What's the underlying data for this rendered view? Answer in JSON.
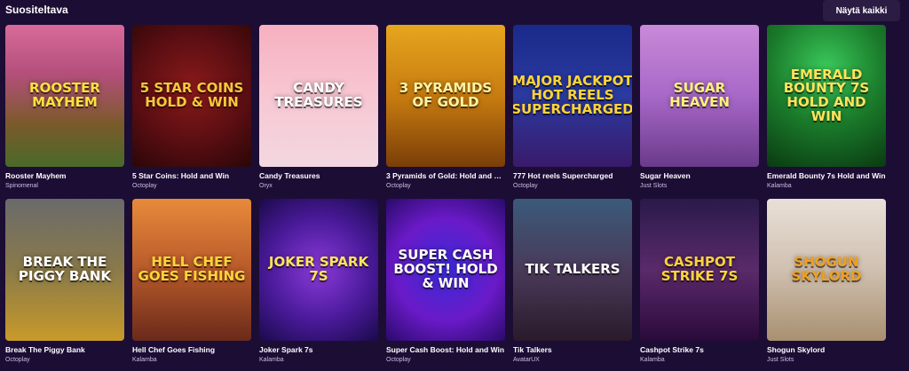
{
  "section": {
    "title": "Suositeltava",
    "show_all_label": "Näytä kaikki"
  },
  "games": [
    {
      "name": "Rooster Mayhem",
      "provider": "Spinomenal",
      "art": "Rooster Mayhem",
      "bg": "linear-gradient(180deg,#d86a9a 0%,#b34f7a 35%,#7a5a2a 70%,#4a6a2a 100%)",
      "color": "#ffe23a"
    },
    {
      "name": "5 Star Coins: Hold and Win",
      "provider": "Octoplay",
      "art": "5 Star Coins Hold & Win",
      "bg": "radial-gradient(circle at 50% 45%,#8a1a1a 0%,#5a0e12 55%,#2a0608 100%)",
      "color": "#f7c83a"
    },
    {
      "name": "Candy Treasures",
      "provider": "Oryx",
      "art": "Candy Treasures",
      "bg": "linear-gradient(180deg,#f6b0c0 0%,#f7c7d2 50%,#f3d7e0 100%)",
      "color": "#ffffff"
    },
    {
      "name": "3 Pyramids of Gold: Hold and Win",
      "provider": "Octoplay",
      "art": "3 Pyramids of Gold",
      "bg": "linear-gradient(180deg,#e6a51e 0%,#c87c10 50%,#7a3e08 100%)",
      "color": "#fff3a0"
    },
    {
      "name": "777 Hot reels Supercharged",
      "provider": "Octoplay",
      "art": "Major Jackpot Hot Reels Supercharged",
      "bg": "linear-gradient(180deg,#1a2a8a 0%,#2a3aa0 50%,#3a1a6a 100%)",
      "color": "#ffd43a"
    },
    {
      "name": "Sugar Heaven",
      "provider": "Just Slots",
      "art": "Sugar Heaven",
      "bg": "linear-gradient(180deg,#c88ad8 0%,#a868c8 50%,#6a3a8a 100%)",
      "color": "#fff27a"
    },
    {
      "name": "Emerald Bounty 7s Hold and Win",
      "provider": "Kalamba",
      "art": "Emerald Bounty 7s Hold and Win",
      "bg": "radial-gradient(circle at 50% 30%,#3ac85a 0%,#1a7a2a 50%,#0a3a12 100%)",
      "color": "#ffe45a"
    },
    {
      "name": "Break The Piggy Bank",
      "provider": "Octoplay",
      "art": "Break the Piggy Bank",
      "bg": "linear-gradient(180deg,#6a6a6a 0%,#8a7a4a 50%,#c89a2a 100%)",
      "color": "#ffffff"
    },
    {
      "name": "Hell Chef Goes Fishing",
      "provider": "Kalamba",
      "art": "Hell Chef Goes Fishing",
      "bg": "linear-gradient(180deg,#e88a3a 0%,#b85a2a 50%,#6a2a1a 100%)",
      "color": "#ffd43a"
    },
    {
      "name": "Joker Spark 7s",
      "provider": "Kalamba",
      "art": "Joker Spark 7s",
      "bg": "radial-gradient(circle at 50% 50%,#8a3ad8 0%,#4a1a9a 55%,#1a0a4a 100%)",
      "color": "#ffe45a"
    },
    {
      "name": "Super Cash Boost: Hold and Win",
      "provider": "Octoplay",
      "art": "Super Cash Boost! Hold & Win",
      "bg": "radial-gradient(circle at 50% 50%,#3a2ad8 0%,#6a1ac8 55%,#2a0a6a 100%)",
      "color": "#ffffff"
    },
    {
      "name": "Tik Talkers",
      "provider": "AvatarUX",
      "art": "Tik Talkers",
      "bg": "linear-gradient(180deg,#3a5a7a 0%,#4a3a5a 50%,#2a1a2a 100%)",
      "color": "#ffffff"
    },
    {
      "name": "Cashpot Strike 7s",
      "provider": "Kalamba",
      "art": "Cashpot Strike 7s",
      "bg": "linear-gradient(180deg,#2a1a4a 0%,#5a2a6a 50%,#2a0a3a 100%)",
      "color": "#ffd43a"
    },
    {
      "name": "Shogun Skylord",
      "provider": "Just Slots",
      "art": "Shogun Skylord",
      "bg": "linear-gradient(180deg,#e8e0d8 0%,#d0c0b0 50%,#a89070 100%)",
      "color": "#f0a020"
    }
  ]
}
